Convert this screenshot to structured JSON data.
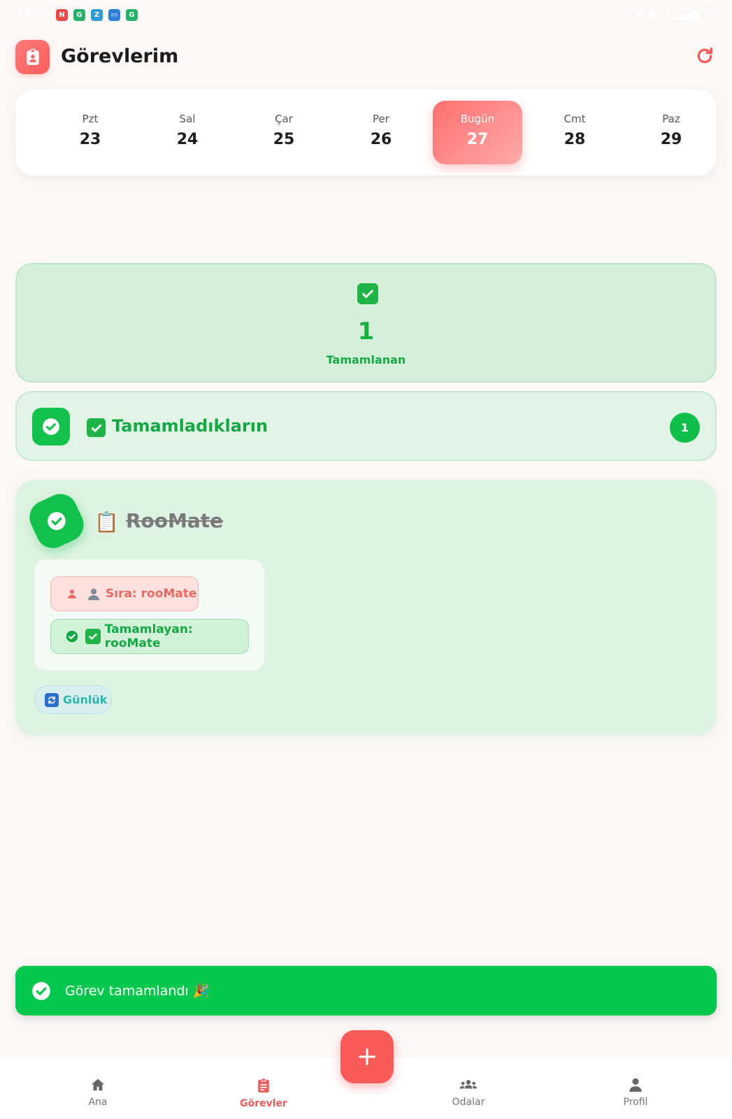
{
  "status_bar": {
    "time": "23:57",
    "battery": "85"
  },
  "header": {
    "title": "Görevlerim"
  },
  "week": {
    "days": [
      {
        "name": "Pzt",
        "date": "23"
      },
      {
        "name": "Sal",
        "date": "24"
      },
      {
        "name": "Çar",
        "date": "25"
      },
      {
        "name": "Per",
        "date": "26"
      },
      {
        "name": "Bugün",
        "date": "27"
      },
      {
        "name": "Cmt",
        "date": "28"
      },
      {
        "name": "Paz",
        "date": "29"
      }
    ],
    "active_index": 4
  },
  "stats": {
    "completed_count": "1",
    "completed_label": "Tamamlanan"
  },
  "section": {
    "title": "Tamamladıkların",
    "count": "1"
  },
  "task": {
    "title": "RooMate",
    "turn_chip": "Sıra: rooMate",
    "completed_by_chip": "Tamamlayan: rooMate",
    "frequency": "Günlük"
  },
  "toast": {
    "message": "Görev tamamlandı 🎉"
  },
  "bottom_nav": {
    "items": [
      {
        "label": "Ana",
        "icon": "home-icon"
      },
      {
        "label": "Görevler",
        "icon": "clipboard-icon"
      },
      {
        "label": "Odalar",
        "icon": "group-icon"
      },
      {
        "label": "Profil",
        "icon": "person-icon"
      }
    ],
    "active": "Görevler"
  },
  "colors": {
    "accent": "#f95b5b",
    "success": "#13c24c",
    "background": "#fcf8f6"
  }
}
